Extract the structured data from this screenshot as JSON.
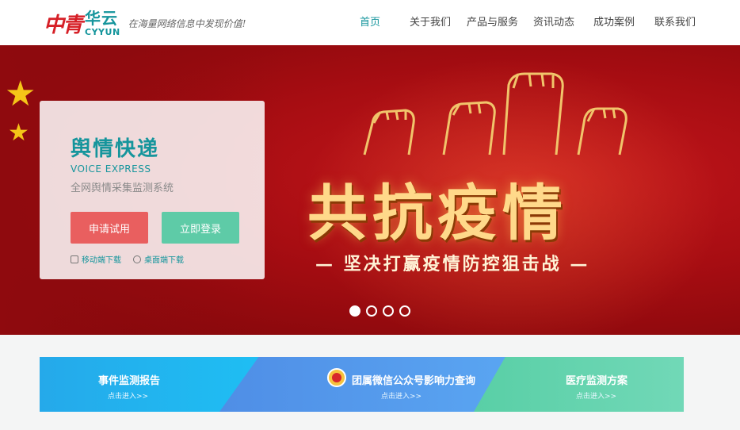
{
  "header": {
    "logo_mark": "中青",
    "logo_cn": "华云",
    "logo_en": "CYYUN",
    "slogan": "在海量网络信息中发现价值!",
    "nav": [
      {
        "label": "首页",
        "active": true
      },
      {
        "label": "关于我们",
        "active": false
      },
      {
        "label": "产品与服务",
        "active": false
      },
      {
        "label": "资讯动态",
        "active": false
      },
      {
        "label": "成功案例",
        "active": false
      },
      {
        "label": "联系我们",
        "active": false
      }
    ]
  },
  "banner": {
    "headline": "共抗疫情",
    "subline": "— 坚决打赢疫情防控狙击战 —",
    "slides_total": 4,
    "current_slide": 1
  },
  "card": {
    "title": "舆情快递",
    "subtitle_en": "VOICE EXPRESS",
    "description": "全网舆情采集监测系统",
    "apply_label": "申请试用",
    "login_label": "立即登录",
    "mobile_download": "移动端下载",
    "desktop_download": "桌面端下载"
  },
  "tiles": [
    {
      "title": "事件监测报告",
      "sub": "点击进入>>"
    },
    {
      "title": "团属微信公众号影响力查询",
      "sub": "点击进入>>"
    },
    {
      "title": "医疗监测方案",
      "sub": "点击进入>>"
    }
  ],
  "colors": {
    "brand": "#15959c",
    "apply_button": "#e95f5f",
    "login_button": "#5ecba7",
    "banner_red": "#b0100f"
  }
}
